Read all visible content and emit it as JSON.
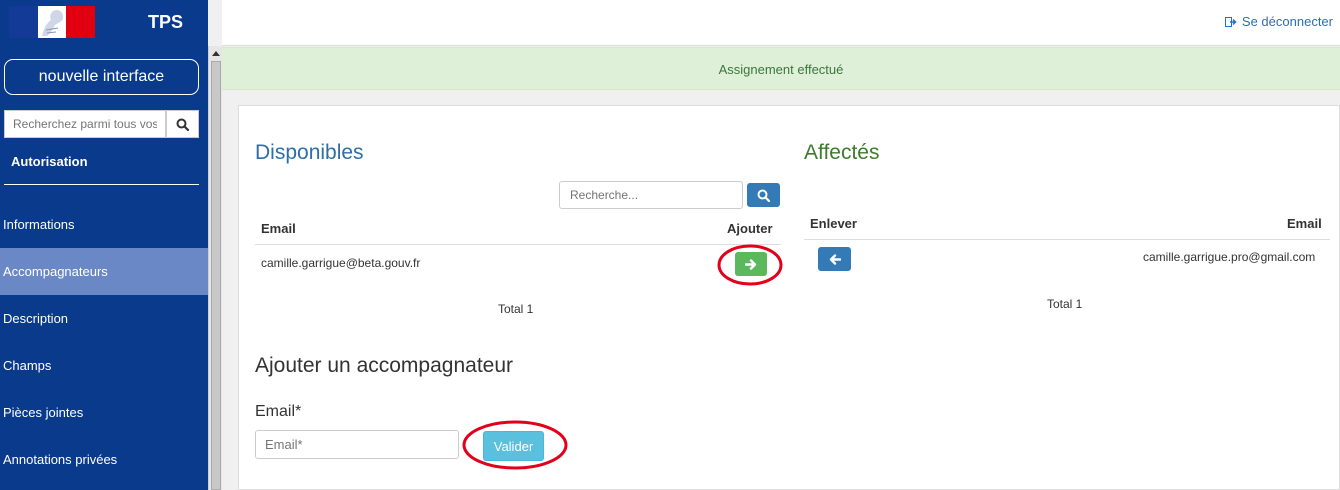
{
  "brand": {
    "title": "TPS"
  },
  "sidebar": {
    "new_ui_label": "nouvelle interface",
    "search_placeholder": "Recherchez parmi tous vos dossiers",
    "section_title": "Autorisation",
    "items": [
      {
        "label": "Informations",
        "active": false
      },
      {
        "label": "Accompagnateurs",
        "active": true
      },
      {
        "label": "Description",
        "active": false
      },
      {
        "label": "Champs",
        "active": false
      },
      {
        "label": "Pièces jointes",
        "active": false
      },
      {
        "label": "Annotations privées",
        "active": false
      }
    ]
  },
  "header": {
    "logout_label": "Se déconnecter"
  },
  "alert": {
    "message": "Assignement effectué"
  },
  "disponibles": {
    "title": "Disponibles",
    "search_placeholder": "Recherche...",
    "col_email": "Email",
    "col_action": "Ajouter",
    "rows": [
      {
        "email": "camille.garrigue@beta.gouv.fr"
      }
    ],
    "total": "Total 1"
  },
  "affectes": {
    "title": "Affectés",
    "col_action": "Enlever",
    "col_email": "Email",
    "rows": [
      {
        "email": "camille.garrigue.pro@gmail.com"
      }
    ],
    "total": "Total 1"
  },
  "add_form": {
    "title": "Ajouter un accompagnateur",
    "email_label": "Email*",
    "email_placeholder": "Email*",
    "submit_label": "Valider"
  },
  "colors": {
    "sidebar": "#0a3a8c",
    "active_item": "#6b88c6",
    "primary": "#337ab7",
    "success": "#5cb85c",
    "info": "#5bc0de",
    "annotation": "#e2001a"
  }
}
